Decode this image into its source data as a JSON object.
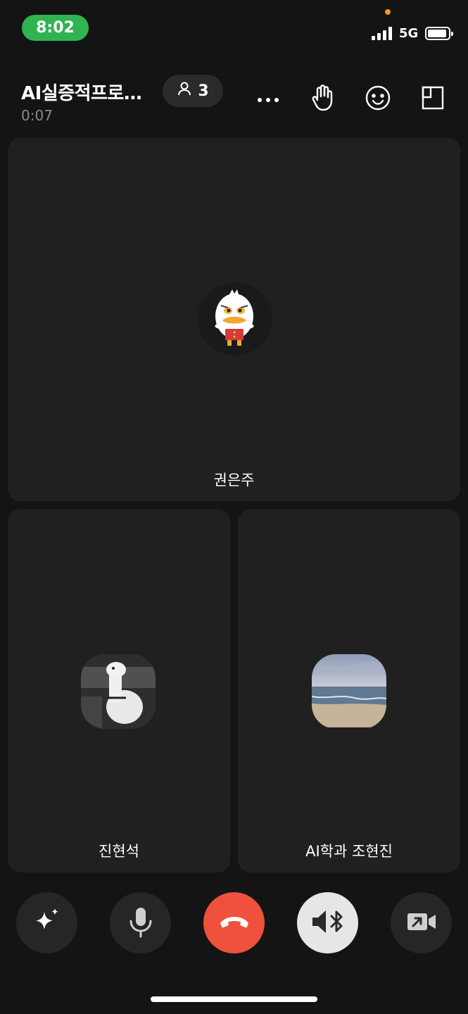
{
  "status_bar": {
    "time": "8:02",
    "network": "5G",
    "colors": {
      "time_pill": "#30b350",
      "privacy_dot": "#f39a1e"
    }
  },
  "header": {
    "title": "AI실증적프로…",
    "elapsed": "0:07",
    "participant_count": "3",
    "icons": [
      "more-icon",
      "raise-hand-icon",
      "emoji-icon",
      "layout-icon"
    ]
  },
  "participants": [
    {
      "name": "권은주",
      "avatar": "duck-character-avatar"
    },
    {
      "name": "진현석",
      "avatar": "alpaca-doll-photo"
    },
    {
      "name": "AI학과 조현진",
      "avatar": "beach-photo"
    }
  ],
  "controls": [
    {
      "name": "effects",
      "icon": "sparkle-icon"
    },
    {
      "name": "microphone",
      "icon": "mic-icon"
    },
    {
      "name": "end-call",
      "icon": "phone-hangup-icon",
      "color": "#f0513c"
    },
    {
      "name": "audio-output",
      "icon": "speaker-bluetooth-icon",
      "color": "#e6e6e6"
    },
    {
      "name": "camera",
      "icon": "video-camera-icon"
    }
  ]
}
